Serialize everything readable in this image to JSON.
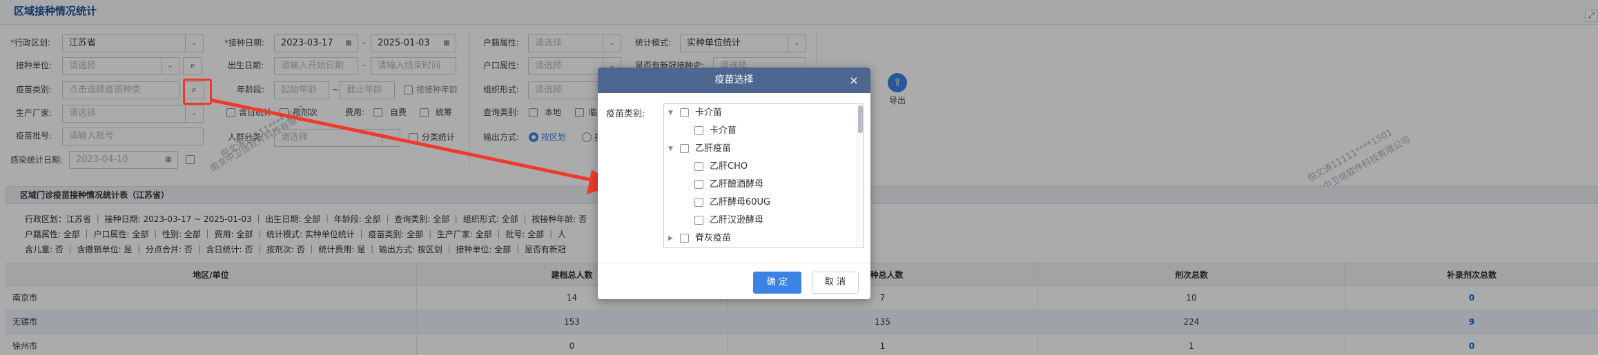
{
  "page_title": "区域接种情况统计",
  "corner_icon": "expand-icon",
  "filters": {
    "region_label": "行政区划:",
    "region_value": "江苏省",
    "unit_label": "接种单位:",
    "unit_placeholder": "请选择",
    "vaccine_type_label": "疫苗类别:",
    "vaccine_type_placeholder": "点击选择疫苗种类",
    "manufacturer_label": "生产厂家:",
    "manufacturer_placeholder": "请选择",
    "batch_label": "疫苗批号:",
    "batch_placeholder": "请输入批号",
    "infection_date_label": "感染统计日期:",
    "infection_date_value": "2023-04-10",
    "vacc_date_label": "接种日期:",
    "vacc_date_start": "2023-03-17",
    "vacc_date_sep": "-",
    "vacc_date_end": "2025-01-03",
    "birth_date_label": "出生日期:",
    "birth_date_start_placeholder": "请输入开始日期",
    "birth_date_sep": "-",
    "birth_date_end_placeholder": "请输入结束时间",
    "age_label": "年龄段:",
    "age_start_placeholder": "起始年龄",
    "age_sep": "~",
    "age_end_placeholder": "截止年龄",
    "by_vacc_age_label": "按接种年龄",
    "include_day_label": "含日统计",
    "by_dose_label": "按剂次",
    "fee_label": "费用:",
    "self_pay_label": "自费",
    "overall_label": "统筹",
    "crowd_label": "人群分类:",
    "crowd_placeholder": "请选择",
    "category_stat_label": "分类统计",
    "household_attr_label": "户籍属性:",
    "household_attr_placeholder": "请选择",
    "household_type_label": "户口属性:",
    "household_type_placeholder": "请选择",
    "org_form_label": "组织形式:",
    "org_form_placeholder": "请选择",
    "query_type_label": "查询类别:",
    "query_local_label": "本地",
    "query_other_label": "临",
    "output_label": "输出方式:",
    "output_area_label": "按区划",
    "output_unit_label": "按",
    "stat_mode_label": "统计模式:",
    "stat_mode_value": "实种单位统计",
    "new_crown_label": "是否有新冠接种史:",
    "new_crown_placeholder": "请选择",
    "export_label": "导出",
    "export_icon": "export-icon"
  },
  "watermarks": [
    "倪文涛11111****1501",
    "南京中卫信软件科技有限公司"
  ],
  "report": {
    "title": "区域门诊疫苗接种情况统计表（江苏省）",
    "info_line1": "行政区划：江苏省  ｜  接种日期: 2023-03-17 ~ 2025-01-03  ｜  出生日期: 全部  ｜  年龄段: 全部  ｜  查询类别: 全部  ｜  组织形式: 全部  ｜  按接种年龄: 否",
    "info_line2": "户籍属性: 全部  ｜  户口属性: 全部  ｜  性别: 全部  ｜  费用: 全部  ｜  统计模式: 实种单位统计  ｜  疫苗类别: 全部  ｜  生产厂家: 全部  ｜  批号: 全部  ｜  人",
    "info_line3": "含儿童: 否  ｜  含撤销单位: 是  ｜  分点合并: 否  ｜  含日统计: 否  ｜  按剂次: 否  ｜  统计费用: 是  ｜  输出方式: 按区划  ｜  接种单位: 全部  ｜  是否有新冠",
    "columns": [
      "地区/单位",
      "建档总人数",
      "接种总人数",
      "剂次总数",
      "补录剂次总数"
    ],
    "rows": [
      {
        "region": "南京市",
        "archived": "14",
        "vaccinated": "7",
        "doses": "10",
        "supplement": "0"
      },
      {
        "region": "无锡市",
        "archived": "153",
        "vaccinated": "135",
        "doses": "224",
        "supplement": "9"
      },
      {
        "region": "徐州市",
        "archived": "0",
        "vaccinated": "1",
        "doses": "1",
        "supplement": "0"
      }
    ]
  },
  "dialog": {
    "title": "疫苗选择",
    "close_icon": "×",
    "category_label": "疫苗类别:",
    "tree": [
      {
        "label": "卡介苗",
        "level": 0,
        "expanded": true
      },
      {
        "label": "卡介苗",
        "level": 1
      },
      {
        "label": "乙肝疫苗",
        "level": 0,
        "expanded": true
      },
      {
        "label": "乙肝CHO",
        "level": 1
      },
      {
        "label": "乙肝酿酒酵母",
        "level": 1
      },
      {
        "label": "乙肝酵母60UG",
        "level": 1
      },
      {
        "label": "乙肝汉逊酵母",
        "level": 1
      },
      {
        "label": "脊灰疫苗",
        "level": 0,
        "expanded": false
      }
    ],
    "ok_label": "确 定",
    "cancel_label": "取 消"
  },
  "annotation": {
    "color": "#ef3b2d"
  }
}
